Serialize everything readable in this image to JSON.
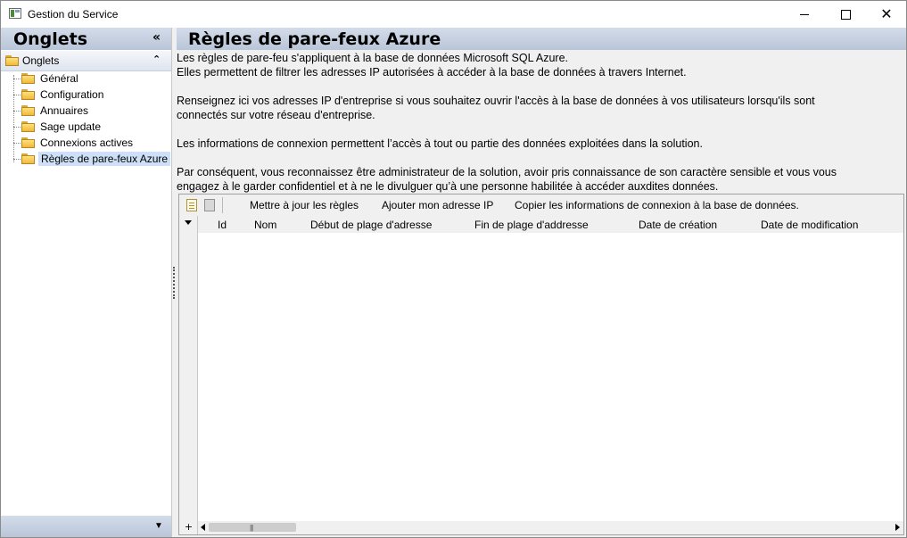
{
  "window": {
    "title": "Gestion du Service",
    "minimize_glyph": "",
    "maximize_glyph": "",
    "close_glyph": "✕"
  },
  "sidebar": {
    "title": "Onglets",
    "collapse_glyph": "«",
    "group": {
      "label": "Onglets",
      "chevron_glyph": "⌃"
    },
    "items": [
      {
        "label": "Général",
        "selected": false
      },
      {
        "label": "Configuration",
        "selected": false
      },
      {
        "label": "Annuaires",
        "selected": false
      },
      {
        "label": "Sage update",
        "selected": false
      },
      {
        "label": "Connexions actives",
        "selected": false
      },
      {
        "label": "Règles de pare-feux Azure",
        "selected": true
      }
    ],
    "footer_glyph": "▼"
  },
  "main": {
    "title": "Règles de pare-feux Azure",
    "description": [
      "Les règles de pare-feu s'appliquent à la base de données Microsoft SQL Azure.",
      "Elles permettent de filtrer les adresses IP autorisées à accéder à la base de données à travers Internet.",
      "Renseignez ici vos adresses IP d'entreprise si vous souhaitez ouvrir l'accès à la base de données à vos utilisateurs lorsqu'ils sont",
      "connectés sur votre réseau d'entreprise.",
      "Les informations de connexion permettent l’accès à tout ou partie des données exploitées dans la solution.",
      "Par conséquent, vous reconnaissez être administrateur de la solution, avoir pris connaissance de son caractère sensible et vous vous",
      "engagez à le garder confidentiel et à ne le divulguer qu’à une personne habilitée à accéder auxdites données."
    ],
    "toolbar": {
      "update_rules": "Mettre à jour les règles",
      "add_my_ip": "Ajouter mon adresse IP",
      "copy_connection": "Copier les informations de connexion à la base de données."
    },
    "grid": {
      "columns": [
        "Id",
        "Nom",
        "Début de plage d'adresse",
        "Fin de plage d'addresse",
        "Date de création",
        "Date de modification"
      ],
      "rows": [],
      "add_row_glyph": "+",
      "scroll_grip": "|||"
    }
  }
}
